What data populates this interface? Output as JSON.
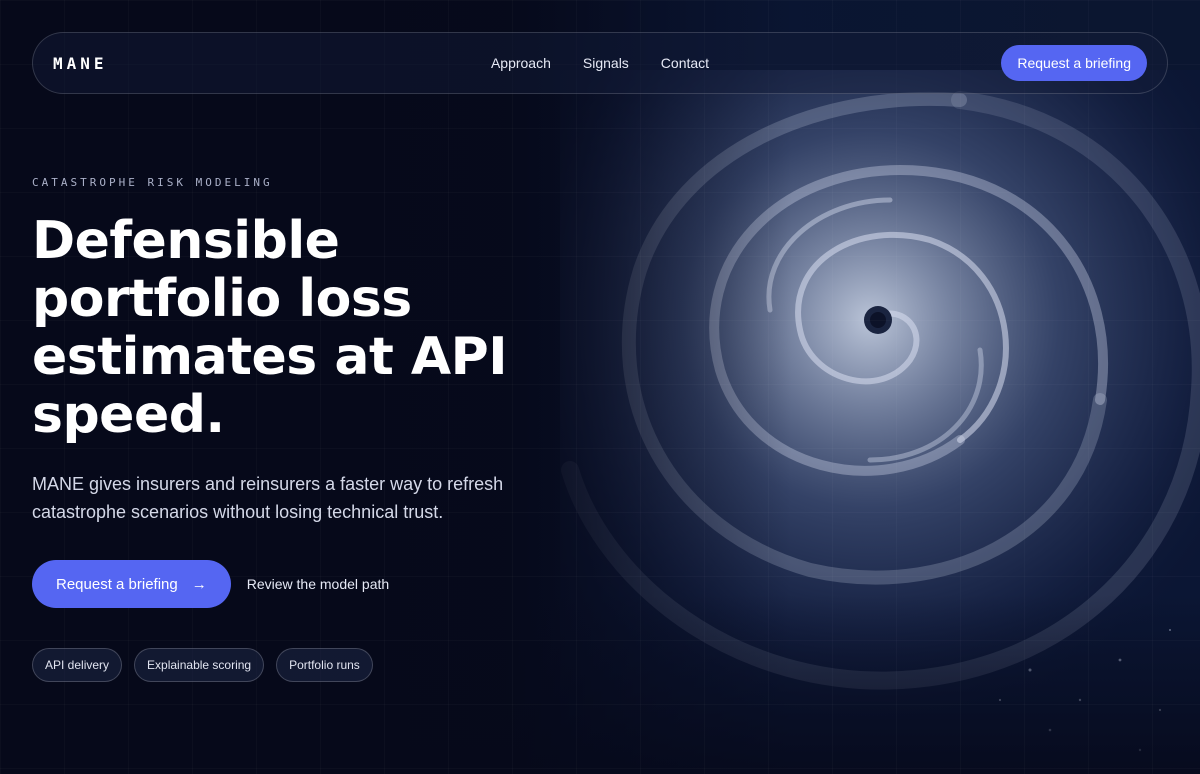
{
  "nav": {
    "brand": "MANE",
    "links": [
      "Approach",
      "Signals",
      "Contact"
    ],
    "cta_label": "Request a briefing"
  },
  "hero": {
    "eyebrow": "CATASTROPHE RISK MODELING",
    "headline": "Defensible portfolio loss estimates at API speed.",
    "subcopy": "MANE gives insurers and reinsurers a faster way to refresh catastrophe scenarios without losing technical trust.",
    "primary_cta": "Request a briefing",
    "primary_cta_icon": "arrow-right-icon",
    "secondary_cta": "Review the model path",
    "chips": [
      "API delivery",
      "Explainable scoring",
      "Portfolio runs"
    ]
  },
  "colors": {
    "accent": "#5566f2",
    "background": "#070b1c"
  }
}
